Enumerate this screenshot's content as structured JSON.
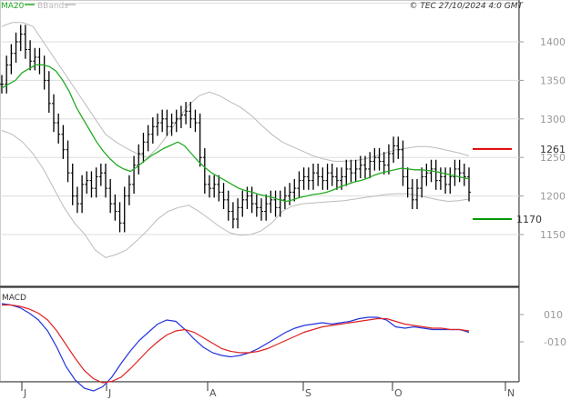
{
  "header": {
    "legend_ma": "MA20",
    "legend_bands": "BBands",
    "copyright": "© TEC 27/10/2024 4:0 GMT",
    "macd_label": "MACD"
  },
  "colors": {
    "ma": "#22aa22",
    "bands": "#bbbbbb",
    "bars": "#000000",
    "resistance": "#dd0000",
    "support": "#009900",
    "macd": "#2233dd",
    "signal": "#dd2222",
    "grid": "#dddddd"
  },
  "chart_data": [
    {
      "type": "ohlc",
      "title": "",
      "y_ticks": [
        "1400",
        "1350",
        "1300",
        "1250",
        "1200",
        "1150"
      ],
      "ylim": [
        1100,
        1455
      ],
      "x_ticks": [
        "J",
        "J",
        "A",
        "S",
        "O",
        "N"
      ],
      "grid": true,
      "levels": [
        {
          "name": "resistance",
          "value": 1261,
          "label": "1261"
        },
        {
          "name": "support",
          "value": 1170,
          "label": "1170"
        }
      ],
      "close": [
        1345,
        1370,
        1385,
        1400,
        1410,
        1390,
        1375,
        1380,
        1370,
        1350,
        1320,
        1295,
        1280,
        1260,
        1230,
        1200,
        1190,
        1215,
        1220,
        1210,
        1225,
        1230,
        1210,
        1190,
        1180,
        1165,
        1200,
        1215,
        1240,
        1255,
        1270,
        1280,
        1290,
        1295,
        1300,
        1290,
        1295,
        1300,
        1305,
        1310,
        1300,
        1295,
        1250,
        1215,
        1210,
        1215,
        1205,
        1195,
        1180,
        1170,
        1185,
        1195,
        1200,
        1190,
        1185,
        1180,
        1190,
        1195,
        1185,
        1195,
        1200,
        1205,
        1210,
        1220,
        1225,
        1220,
        1230,
        1225,
        1220,
        1230,
        1225,
        1220,
        1225,
        1235,
        1230,
        1235,
        1240,
        1235,
        1245,
        1250,
        1245,
        1240,
        1255,
        1265,
        1260,
        1225,
        1210,
        1195,
        1210,
        1225,
        1230,
        1235,
        1220,
        1225,
        1215,
        1225,
        1235,
        1230,
        1225,
        1205
      ],
      "ma20": [
        1340,
        1345,
        1350,
        1360,
        1365,
        1370,
        1370,
        1368,
        1362,
        1350,
        1335,
        1315,
        1300,
        1285,
        1270,
        1258,
        1248,
        1240,
        1235,
        1232,
        1238,
        1245,
        1252,
        1257,
        1262,
        1266,
        1270,
        1265,
        1255,
        1245,
        1237,
        1230,
        1225,
        1220,
        1215,
        1210,
        1207,
        1205,
        1202,
        1200,
        1198,
        1195,
        1193,
        1195,
        1198,
        1200,
        1202,
        1203,
        1205,
        1208,
        1212,
        1215,
        1218,
        1220,
        1223,
        1227,
        1230,
        1232,
        1234,
        1236,
        1235,
        1234,
        1234,
        1233,
        1232,
        1230,
        1228,
        1226,
        1224,
        1222
      ],
      "bb_upper": [
        1420,
        1425,
        1425,
        1420,
        1400,
        1380,
        1360,
        1340,
        1320,
        1300,
        1280,
        1270,
        1262,
        1255,
        1250,
        1262,
        1280,
        1300,
        1318,
        1330,
        1335,
        1330,
        1322,
        1315,
        1305,
        1292,
        1280,
        1270,
        1264,
        1258,
        1252,
        1248,
        1245,
        1245,
        1246,
        1248,
        1252,
        1256,
        1260,
        1262,
        1264,
        1264,
        1262,
        1259,
        1256,
        1252
      ],
      "bb_lower": [
        1285,
        1280,
        1270,
        1255,
        1235,
        1210,
        1185,
        1165,
        1150,
        1130,
        1120,
        1124,
        1130,
        1142,
        1155,
        1170,
        1180,
        1185,
        1188,
        1180,
        1170,
        1160,
        1152,
        1149,
        1150,
        1155,
        1165,
        1180,
        1187,
        1190,
        1191,
        1192,
        1193,
        1194,
        1196,
        1198,
        1200,
        1202,
        1203,
        1203,
        1201,
        1198,
        1195,
        1193,
        1194,
        1196
      ],
      "macd_ticks": [
        "010",
        "-010"
      ],
      "macd": [
        18,
        17,
        15,
        11,
        6,
        -2,
        -14,
        -28,
        -38,
        -44,
        -46,
        -43,
        -36,
        -26,
        -17,
        -9,
        -3,
        3,
        6,
        5,
        -1,
        -8,
        -14,
        -18,
        -20,
        -21,
        -20,
        -18,
        -15,
        -11,
        -7,
        -3,
        0,
        2,
        3,
        4,
        3,
        4,
        5,
        7,
        8,
        8,
        6,
        1,
        0,
        1,
        0,
        -1,
        -1,
        -1,
        -1,
        -3
      ],
      "macd_signal": [
        17,
        17,
        16,
        14,
        11,
        6,
        -2,
        -12,
        -22,
        -31,
        -37,
        -40,
        -39,
        -36,
        -30,
        -23,
        -16,
        -10,
        -5,
        -2,
        -1,
        -3,
        -7,
        -11,
        -15,
        -17,
        -18,
        -18,
        -17,
        -15,
        -12,
        -9,
        -6,
        -3,
        -1,
        1,
        2,
        3,
        4,
        5,
        6,
        7,
        7,
        5,
        3,
        2,
        1,
        0,
        0,
        -1,
        -1,
        -2
      ]
    }
  ]
}
